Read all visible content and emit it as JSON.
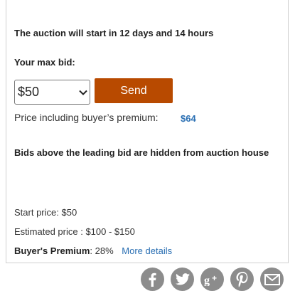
{
  "auction": {
    "start_message": "The auction will start in 12 days and 14 hours",
    "max_bid_label": "Your max bid:",
    "selected_bid": "$50",
    "send_label": "Send",
    "premium_label": "Price including buyer’s premium:",
    "premium_value": "$64",
    "hidden_note": "Bids above the leading bid are hidden from auction house"
  },
  "details": {
    "start_price_label": "Start price:",
    "start_price_value": "$50",
    "estimated_label": "Estimated price :",
    "estimated_value": "$100 - $150",
    "premium_label": "Buyer's Premium",
    "premium_value": ": 28%",
    "more_details": "More details"
  },
  "share": {
    "icons": [
      "facebook-icon",
      "twitter-icon",
      "google-plus-icon",
      "pinterest-icon",
      "email-icon"
    ],
    "color": "#8c8c8c"
  },
  "colors": {
    "send_button": "#b84a00",
    "link": "#2a6fb3"
  }
}
